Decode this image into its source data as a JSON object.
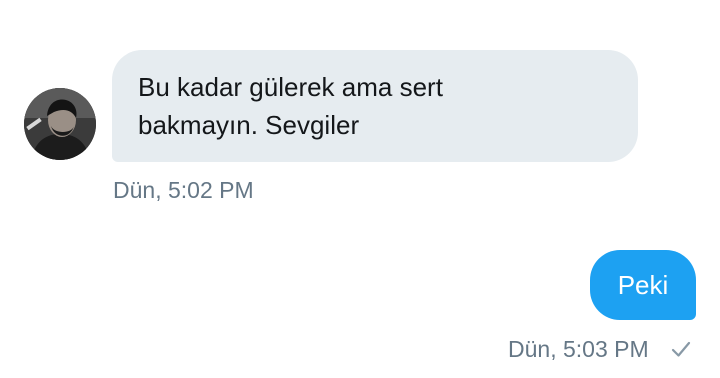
{
  "conversation": {
    "incoming": {
      "avatar_icon": "person-avatar",
      "text": "Bu kadar gülerek ama sert\nbakmayın. Sevgiler",
      "timestamp": "Dün, 5:02 PM",
      "bubble_color": "#e6ecf0"
    },
    "outgoing": {
      "text": "Peki",
      "timestamp": "Dün, 5:03 PM",
      "status_icon": "check-icon",
      "bubble_color": "#1da1f2"
    }
  }
}
